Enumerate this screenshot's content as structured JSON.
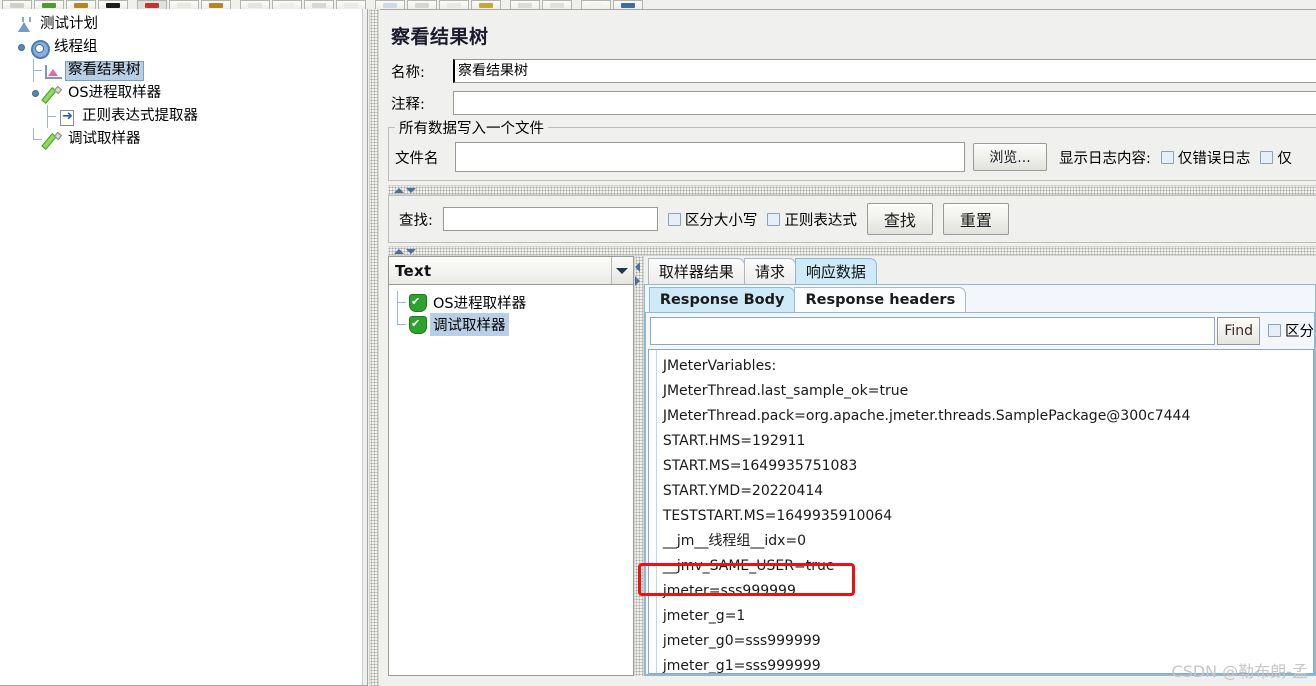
{
  "toolbar": {
    "buttons": [
      {
        "name": "new-button",
        "color": "#cfcfc8"
      },
      {
        "name": "templates-button",
        "color": "#4f9b2c"
      },
      {
        "name": "open-button",
        "color": "#b8861f"
      },
      {
        "name": "close-button",
        "color": "#1c1c1c"
      },
      {
        "name": "save-button",
        "color": "#c3342f"
      },
      {
        "name": "copy-button",
        "color": "#e8e8e2"
      },
      {
        "name": "paste-button",
        "color": "#b8861f"
      },
      {
        "name": "cut-button",
        "color": "#e4e4de"
      },
      {
        "name": "expand-button",
        "color": "#eeeee8"
      },
      {
        "name": "collapse-button",
        "color": "#d8d8d2"
      },
      {
        "name": "toggle-button",
        "color": "#eaeae4"
      },
      {
        "name": "start-button",
        "color": "#cfd8e6"
      },
      {
        "name": "start-no-timers-button",
        "color": "#d6d6d0"
      },
      {
        "name": "stop-button",
        "color": "#e8e8e2"
      },
      {
        "name": "shutdown-button",
        "color": "#c8a83a"
      },
      {
        "name": "clear-button",
        "color": "#dcdcd6"
      },
      {
        "name": "clear-all-button",
        "color": "#e0e0da"
      },
      {
        "name": "search-button",
        "color": "#f2f2ec"
      },
      {
        "name": "reset-search-button",
        "color": "#3a6ea5"
      }
    ]
  },
  "tree": {
    "nodes": [
      {
        "label": "测试计划",
        "icon": "test-plan-icon",
        "selected": false,
        "depth": 0
      },
      {
        "label": "线程组",
        "icon": "thread-group-icon",
        "selected": false,
        "depth": 1
      },
      {
        "label": "察看结果树",
        "icon": "view-results-tree-icon",
        "selected": true,
        "depth": 2
      },
      {
        "label": "OS进程取样器",
        "icon": "sampler-icon",
        "selected": false,
        "depth": 2
      },
      {
        "label": "正则表达式提取器",
        "icon": "post-processor-icon",
        "selected": false,
        "depth": 3
      },
      {
        "label": "调试取样器",
        "icon": "sampler-icon",
        "selected": false,
        "depth": 2
      }
    ]
  },
  "main": {
    "panel_title": "察看结果树",
    "name_label": "名称:",
    "name_value": "察看结果树",
    "comment_label": "注释:",
    "comment_value": "",
    "file_group_title": "所有数据写入一个文件",
    "filename_label": "文件名",
    "filename_value": "",
    "browse_button": "浏览...",
    "log_display_label": "显示日志内容:",
    "log_errors_only": "仅错误日志",
    "log_successes_only": "仅",
    "search": {
      "label": "查找:",
      "value": "",
      "case_sensitive": "区分大小写",
      "regex": "正则表达式",
      "find_button": "查找",
      "reset_button": "重置"
    }
  },
  "results": {
    "renderer_selected": "Text",
    "items": [
      {
        "label": "OS进程取样器",
        "status": "success",
        "selected": false
      },
      {
        "label": "调试取样器",
        "status": "success",
        "selected": true
      }
    ]
  },
  "detail": {
    "tabs": [
      {
        "label": "取样器结果",
        "active": false
      },
      {
        "label": "请求",
        "active": false
      },
      {
        "label": "响应数据",
        "active": true
      }
    ],
    "subtabs": [
      {
        "label": "Response Body",
        "active": true
      },
      {
        "label": "Response headers",
        "active": false
      }
    ],
    "find": {
      "value": "",
      "button": "Find",
      "case_sensitive": "区分"
    },
    "response_lines": [
      "JMeterVariables:",
      "JMeterThread.last_sample_ok=true",
      "JMeterThread.pack=org.apache.jmeter.threads.SamplePackage@300c7444",
      "START.HMS=192911",
      "START.MS=1649935751083",
      "START.YMD=20220414",
      "TESTSTART.MS=1649935910064",
      "__jm__线程组__idx=0",
      "__jmv_SAME_USER=true",
      "jmeter=sss999999",
      "jmeter_g=1",
      "jmeter_g0=sss999999",
      "jmeter_g1=sss999999"
    ],
    "highlight_line_index": 9,
    "highlight_color": "#ee1111"
  },
  "watermark": "CSDN @勒布朗-孟"
}
